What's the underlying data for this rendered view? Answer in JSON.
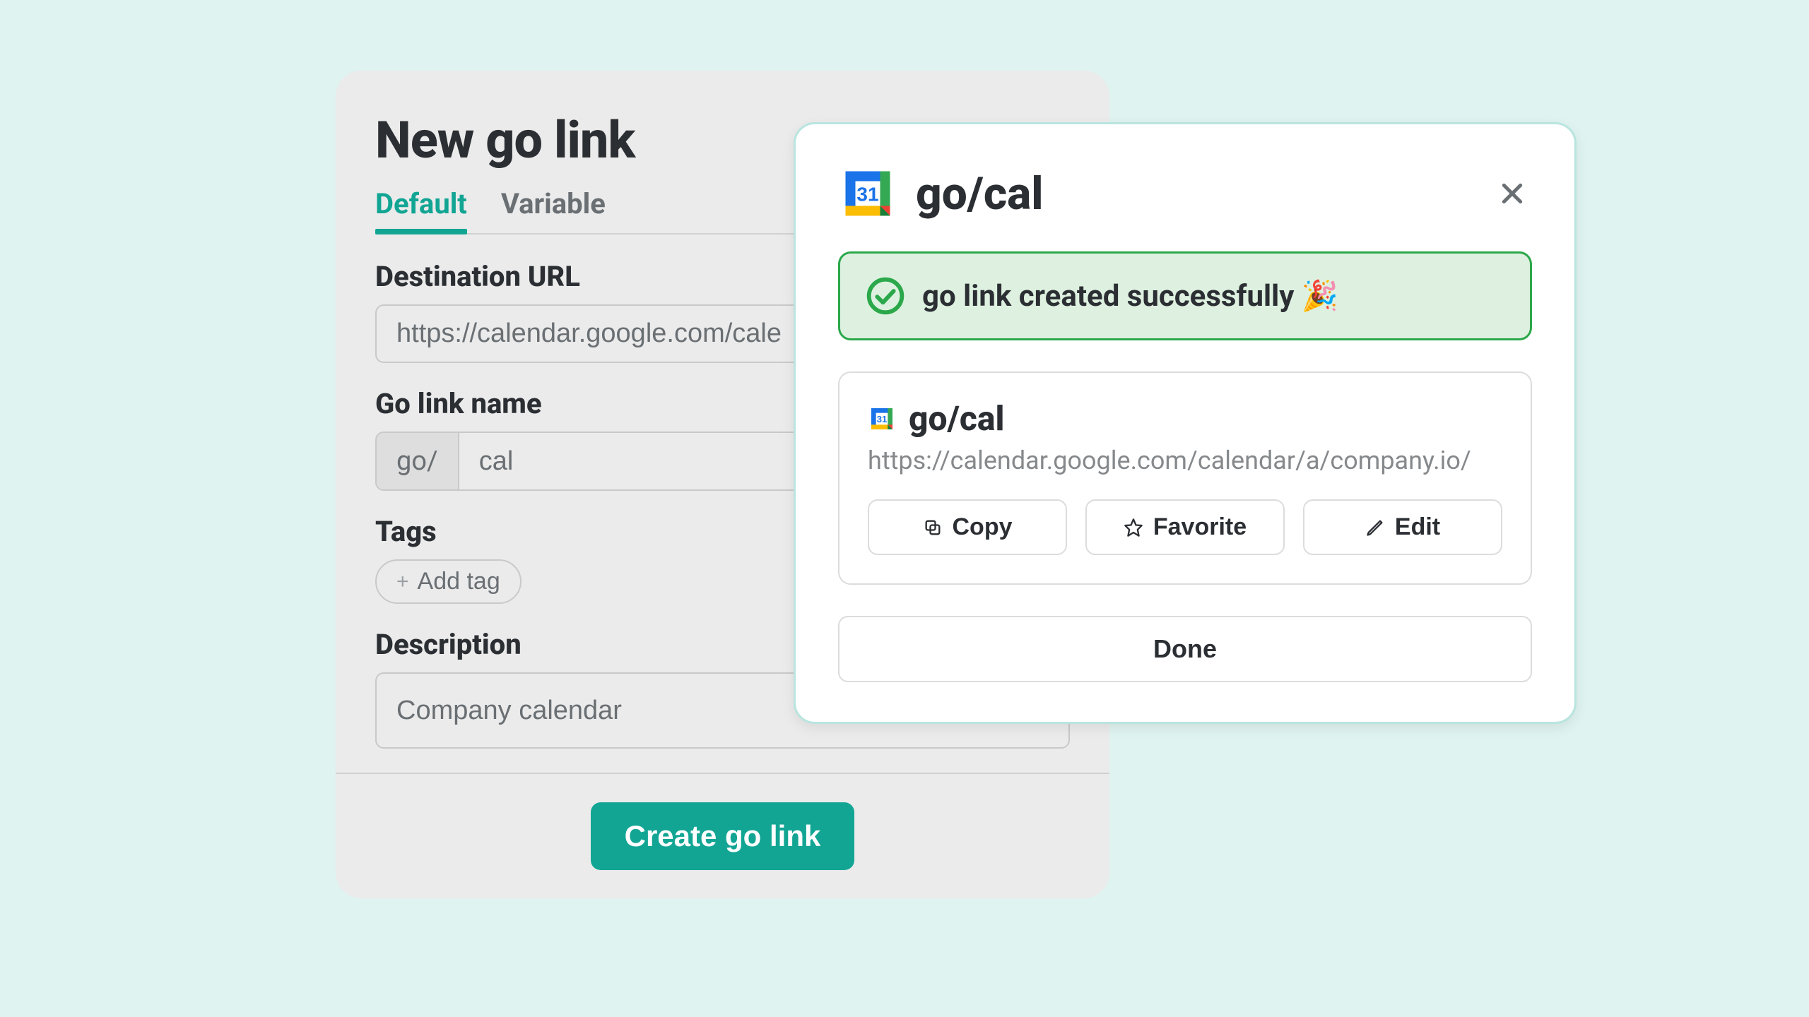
{
  "form": {
    "title": "New go link",
    "tabs": {
      "default": "Default",
      "variable": "Variable"
    },
    "dest_label": "Destination URL",
    "dest_value": "https://calendar.google.com/cale",
    "name_label": "Go link name",
    "name_prefix": "go/",
    "name_value": "cal",
    "tags_label": "Tags",
    "add_tag": "Add tag",
    "desc_label": "Description",
    "desc_value": "Company calendar",
    "create_btn": "Create go link"
  },
  "modal": {
    "title": "go/cal",
    "success_msg": "go link created successfully 🎉",
    "link_title": "go/cal",
    "link_url": "https://calendar.google.com/calendar/a/company.io/",
    "copy": "Copy",
    "favorite": "Favorite",
    "edit": "Edit",
    "done": "Done"
  },
  "colors": {
    "accent": "#12a594",
    "success_border": "#2ba84a",
    "success_bg": "#def1e0"
  }
}
